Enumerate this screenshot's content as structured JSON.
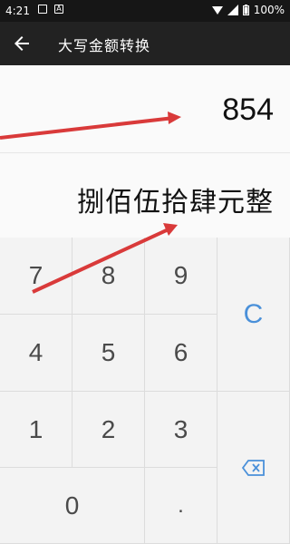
{
  "status": {
    "time": "4:21",
    "battery": "100%"
  },
  "appbar": {
    "title": "大写金额转换"
  },
  "display": {
    "number": "854",
    "result": "捌佰伍拾肆元整"
  },
  "keys": {
    "k7": "7",
    "k8": "8",
    "k9": "9",
    "k4": "4",
    "k5": "5",
    "k6": "6",
    "k1": "1",
    "k2": "2",
    "k3": "3",
    "k0": "0",
    "dot": ".",
    "clear": "C"
  },
  "colors": {
    "accent": "#4a90d9",
    "arrow": "#d93a3a",
    "appbar": "#222222",
    "statusbar": "#161616"
  },
  "icons": {
    "back": "arrow-left-icon",
    "delete": "backspace-icon"
  }
}
